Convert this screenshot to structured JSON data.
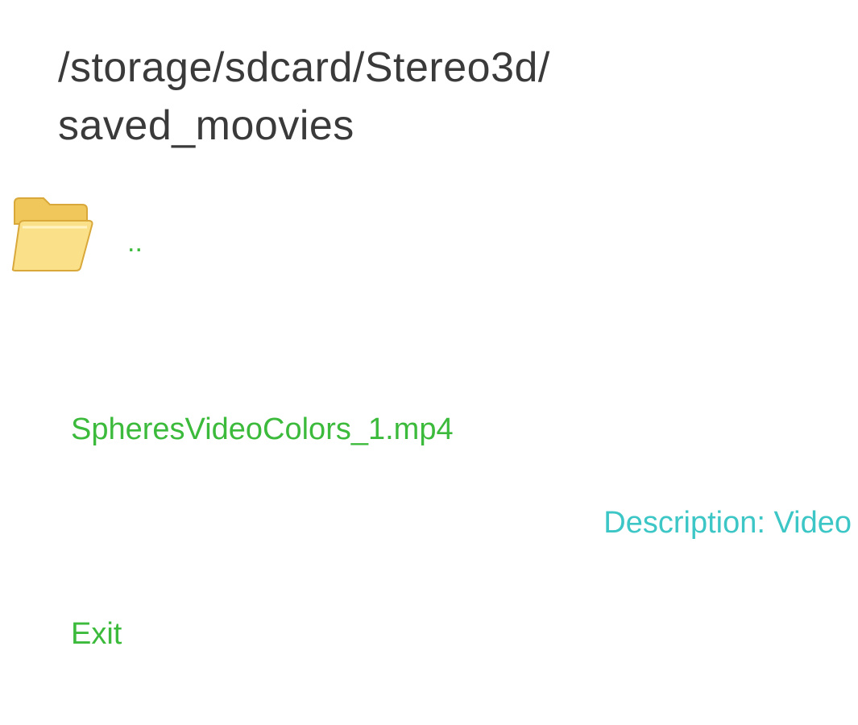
{
  "header": {
    "path_line1": "/storage/sdcard/Stereo3d/",
    "path_line2": "saved_moovies"
  },
  "list": {
    "parent": {
      "icon": "folder-icon",
      "label": ".."
    },
    "files": [
      {
        "name": "SpheresVideoColors_1.mp4",
        "description": "Description: Video"
      }
    ]
  },
  "footer": {
    "exit_label": "Exit"
  },
  "colors": {
    "title": "#3a3a3a",
    "item_green": "#3cba3c",
    "description_cyan": "#3cc6c6",
    "folder_yellow": "#f7d774"
  }
}
